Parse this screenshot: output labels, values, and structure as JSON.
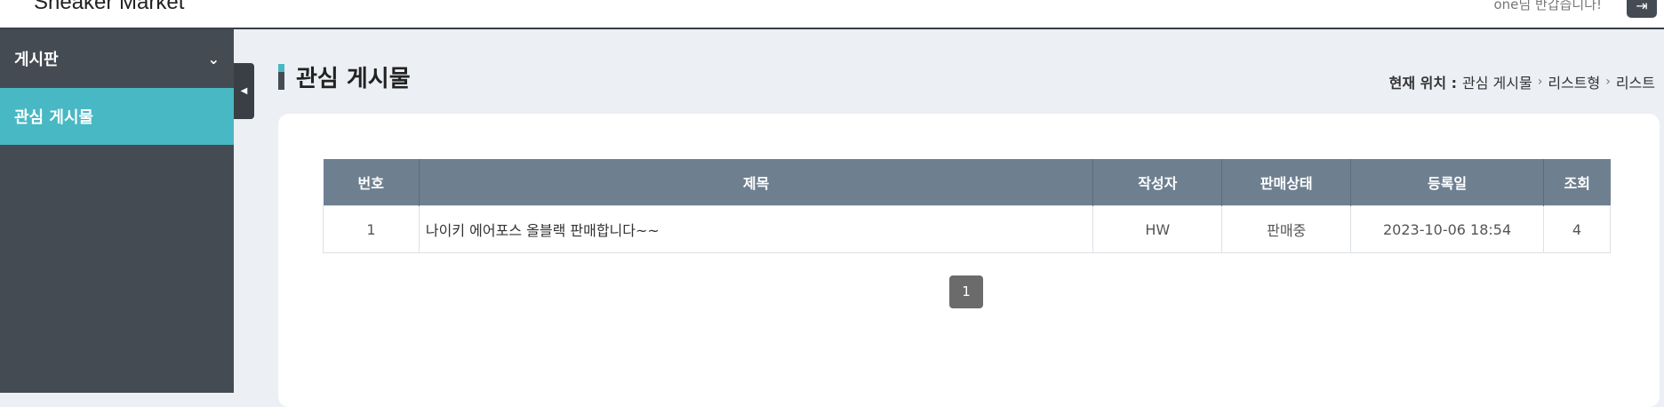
{
  "header": {
    "brand": "Sneaker Market",
    "welcome": "one님 반갑습니다!",
    "logout_icon": "logout-icon"
  },
  "sidebar": {
    "section": "게시판",
    "items": [
      {
        "label": "관심 게시물"
      }
    ]
  },
  "page": {
    "title": "관심 게시물"
  },
  "breadcrumb": {
    "label": "현재 위치 :",
    "items": [
      "관심 게시물",
      "리스트형",
      "리스트"
    ]
  },
  "table": {
    "columns": [
      "번호",
      "제목",
      "작성자",
      "판매상태",
      "등록일",
      "조회"
    ],
    "rows": [
      [
        "1",
        "나이키 에어포스 올블랙 판매합니다~~",
        "HW",
        "판매중",
        "2023-10-06 18:54",
        "4"
      ]
    ]
  },
  "pagination": {
    "current": "1"
  },
  "colors": {
    "accent": "#48b8c4",
    "sidebar": "#454b53",
    "table_header": "#6e7f90"
  }
}
